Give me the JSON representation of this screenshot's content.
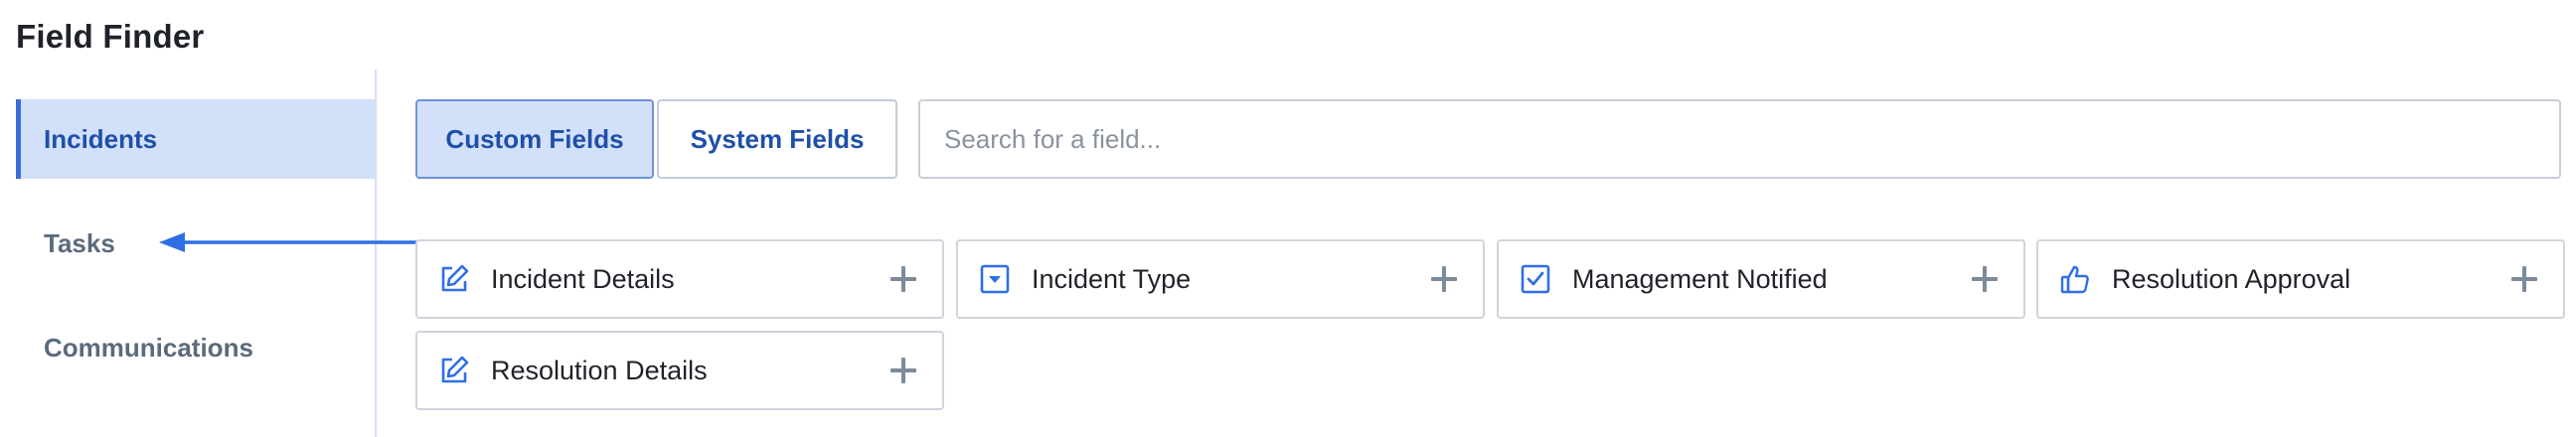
{
  "page": {
    "title": "Field Finder"
  },
  "sidebar": {
    "items": [
      {
        "label": "Incidents",
        "active": true
      },
      {
        "label": "Tasks",
        "active": false
      },
      {
        "label": "Communications",
        "active": false
      }
    ]
  },
  "tabs": [
    {
      "label": "Custom Fields",
      "active": true
    },
    {
      "label": "System Fields",
      "active": false
    }
  ],
  "search": {
    "placeholder": "Search for a field...",
    "value": ""
  },
  "fields": [
    {
      "label": "Incident Details",
      "icon": "edit-icon"
    },
    {
      "label": "Incident Type",
      "icon": "dropdown-select-icon"
    },
    {
      "label": "Management Notified",
      "icon": "checkbox-icon"
    },
    {
      "label": "Resolution Approval",
      "icon": "thumbs-up-icon"
    },
    {
      "label": "Resolution Details",
      "icon": "edit-icon"
    }
  ],
  "colors": {
    "accent": "#2f6fe4",
    "active_bg": "#d3e0fa",
    "active_text": "#1f4fa8"
  }
}
